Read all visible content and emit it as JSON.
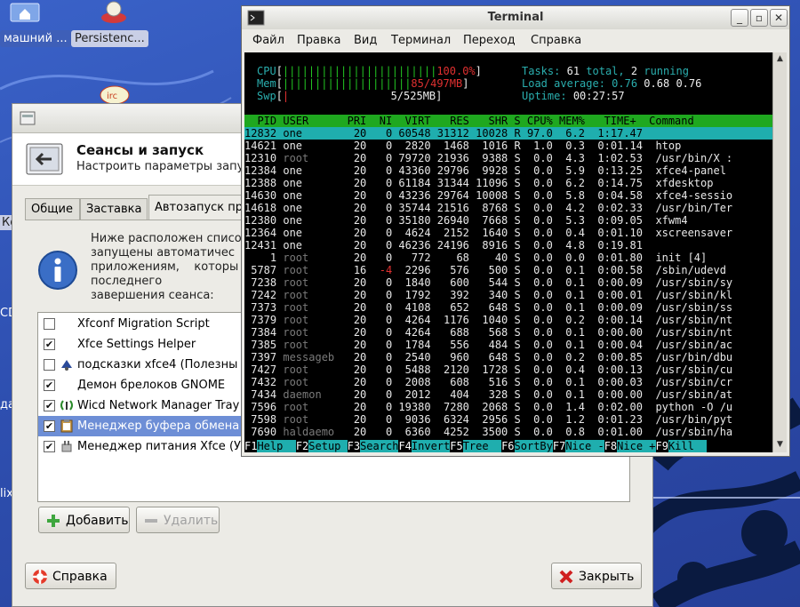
{
  "desktop": {
    "icons": [
      {
        "label": "машний ...",
        "icon": "home-icon"
      },
      {
        "label": "Persistenc...",
        "icon": "persistence-icon"
      }
    ],
    "side_labels": [
      "Ко",
      "CD",
      "да",
      "lix"
    ]
  },
  "settings_dialog": {
    "title": "Сеансы и запуск",
    "subtitle": "Настроить параметры запу",
    "tabs": [
      "Общие",
      "Заставка",
      "Автозапуск пр"
    ],
    "info_text": "Ниже расположен списо\nзапущены автоматичес\nприложениям,    которы\nпоследнего\nзавершения сеанса:",
    "autostart_items": [
      {
        "label": "Xfconf Migration Script",
        "checked": false,
        "icon": "none"
      },
      {
        "label": "Xfce Settings Helper",
        "checked": true,
        "icon": "none"
      },
      {
        "label": "подсказки xfce4 (Полезны",
        "checked": false,
        "icon": "tips-icon"
      },
      {
        "label": "Демон брелоков GNOME",
        "checked": true,
        "icon": "none"
      },
      {
        "label": "Wicd Network Manager Tray",
        "checked": true,
        "icon": "wicd-icon"
      },
      {
        "label": "Менеджер буфера обмена",
        "checked": true,
        "icon": "clipboard-icon"
      },
      {
        "label": "Менеджер питания Xfce (У",
        "checked": true,
        "icon": "power-icon"
      }
    ],
    "selected_index": 5,
    "add_button": "Добавить",
    "remove_button": "Удалить",
    "help_button": "Справка",
    "close_button": "Закрыть"
  },
  "terminal": {
    "title": "Terminal",
    "menu": [
      "Файл",
      "Правка",
      "Вид",
      "Терминал",
      "Переход",
      "Справка"
    ],
    "htop": {
      "cpu_label": "CPU",
      "cpu_bar": "||||||||||||||||||||||||",
      "cpu_value": "100.0%",
      "mem_label": "Mem",
      "mem_bar": "||||||||||||||||||||",
      "mem_value": "85/497MB",
      "swp_label": "Swp",
      "swp_bar": "|",
      "swp_value": "5/525MB",
      "tasks_label": "Tasks:",
      "tasks_total": "61",
      "tasks_total_label": "total,",
      "tasks_running": "2",
      "tasks_running_label": "running",
      "load_label": "Load average:",
      "load_1": "0.76",
      "load_5": "0.68",
      "load_15": "0.76",
      "uptime_label": "Uptime:",
      "uptime": "00:27:57",
      "header": "  PID USER      PRI  NI  VIRT   RES   SHR S CPU% MEM%   TIME+  Command",
      "processes": [
        {
          "pid": "12832",
          "user": "one",
          "pri": "20",
          "ni": "0",
          "virt": "60548",
          "res": "31312",
          "shr": "10028",
          "s": "R",
          "cpu": "97.0",
          "mem": "6.2",
          "time": "1:17.47",
          "cmd": ""
        },
        {
          "pid": "14621",
          "user": "one",
          "pri": "20",
          "ni": "0",
          "virt": "2820",
          "res": "1468",
          "shr": "1016",
          "s": "R",
          "cpu": "1.0",
          "mem": "0.3",
          "time": "0:01.14",
          "cmd": "htop"
        },
        {
          "pid": "12310",
          "user": "root",
          "pri": "20",
          "ni": "0",
          "virt": "79720",
          "res": "21936",
          "shr": "9388",
          "s": "S",
          "cpu": "0.0",
          "mem": "4.3",
          "time": "1:02.53",
          "cmd": "/usr/bin/X :"
        },
        {
          "pid": "12384",
          "user": "one",
          "pri": "20",
          "ni": "0",
          "virt": "43360",
          "res": "29796",
          "shr": "9928",
          "s": "S",
          "cpu": "0.0",
          "mem": "5.9",
          "time": "0:13.25",
          "cmd": "xfce4-panel"
        },
        {
          "pid": "12388",
          "user": "one",
          "pri": "20",
          "ni": "0",
          "virt": "61184",
          "res": "31344",
          "shr": "11096",
          "s": "S",
          "cpu": "0.0",
          "mem": "6.2",
          "time": "0:14.75",
          "cmd": "xfdesktop"
        },
        {
          "pid": "14630",
          "user": "one",
          "pri": "20",
          "ni": "0",
          "virt": "43236",
          "res": "29764",
          "shr": "10008",
          "s": "S",
          "cpu": "0.0",
          "mem": "5.8",
          "time": "0:04.58",
          "cmd": "xfce4-sessio"
        },
        {
          "pid": "14618",
          "user": "one",
          "pri": "20",
          "ni": "0",
          "virt": "35744",
          "res": "21516",
          "shr": "8768",
          "s": "S",
          "cpu": "0.0",
          "mem": "4.2",
          "time": "0:02.33",
          "cmd": "/usr/bin/Ter"
        },
        {
          "pid": "12380",
          "user": "one",
          "pri": "20",
          "ni": "0",
          "virt": "35180",
          "res": "26940",
          "shr": "7668",
          "s": "S",
          "cpu": "0.0",
          "mem": "5.3",
          "time": "0:09.05",
          "cmd": "xfwm4"
        },
        {
          "pid": "12364",
          "user": "one",
          "pri": "20",
          "ni": "0",
          "virt": "4624",
          "res": "2152",
          "shr": "1640",
          "s": "S",
          "cpu": "0.0",
          "mem": "0.4",
          "time": "0:01.10",
          "cmd": "xscreensaver"
        },
        {
          "pid": "12431",
          "user": "one",
          "pri": "20",
          "ni": "0",
          "virt": "46236",
          "res": "24196",
          "shr": "8916",
          "s": "S",
          "cpu": "0.0",
          "mem": "4.8",
          "time": "0:19.81",
          "cmd": ""
        },
        {
          "pid": "1",
          "user": "root",
          "pri": "20",
          "ni": "0",
          "virt": "772",
          "res": "68",
          "shr": "40",
          "s": "S",
          "cpu": "0.0",
          "mem": "0.0",
          "time": "0:01.80",
          "cmd": "init [4]"
        },
        {
          "pid": "5787",
          "user": "root",
          "pri": "16",
          "ni": "-4",
          "virt": "2296",
          "res": "576",
          "shr": "500",
          "s": "S",
          "cpu": "0.0",
          "mem": "0.1",
          "time": "0:00.58",
          "cmd": "/sbin/udevd"
        },
        {
          "pid": "7238",
          "user": "root",
          "pri": "20",
          "ni": "0",
          "virt": "1840",
          "res": "600",
          "shr": "544",
          "s": "S",
          "cpu": "0.0",
          "mem": "0.1",
          "time": "0:00.09",
          "cmd": "/usr/sbin/sy"
        },
        {
          "pid": "7242",
          "user": "root",
          "pri": "20",
          "ni": "0",
          "virt": "1792",
          "res": "392",
          "shr": "340",
          "s": "S",
          "cpu": "0.0",
          "mem": "0.1",
          "time": "0:00.01",
          "cmd": "/usr/sbin/kl"
        },
        {
          "pid": "7373",
          "user": "root",
          "pri": "20",
          "ni": "0",
          "virt": "4108",
          "res": "652",
          "shr": "648",
          "s": "S",
          "cpu": "0.0",
          "mem": "0.1",
          "time": "0:00.09",
          "cmd": "/usr/sbin/ss"
        },
        {
          "pid": "7379",
          "user": "root",
          "pri": "20",
          "ni": "0",
          "virt": "4264",
          "res": "1176",
          "shr": "1040",
          "s": "S",
          "cpu": "0.0",
          "mem": "0.2",
          "time": "0:00.14",
          "cmd": "/usr/sbin/nt"
        },
        {
          "pid": "7384",
          "user": "root",
          "pri": "20",
          "ni": "0",
          "virt": "4264",
          "res": "688",
          "shr": "568",
          "s": "S",
          "cpu": "0.0",
          "mem": "0.1",
          "time": "0:00.00",
          "cmd": "/usr/sbin/nt"
        },
        {
          "pid": "7385",
          "user": "root",
          "pri": "20",
          "ni": "0",
          "virt": "1784",
          "res": "556",
          "shr": "484",
          "s": "S",
          "cpu": "0.0",
          "mem": "0.1",
          "time": "0:00.04",
          "cmd": "/usr/sbin/ac"
        },
        {
          "pid": "7397",
          "user": "messageb",
          "pri": "20",
          "ni": "0",
          "virt": "2540",
          "res": "960",
          "shr": "648",
          "s": "S",
          "cpu": "0.0",
          "mem": "0.2",
          "time": "0:00.85",
          "cmd": "/usr/bin/dbu"
        },
        {
          "pid": "7427",
          "user": "root",
          "pri": "20",
          "ni": "0",
          "virt": "5488",
          "res": "2120",
          "shr": "1728",
          "s": "S",
          "cpu": "0.0",
          "mem": "0.4",
          "time": "0:00.13",
          "cmd": "/usr/sbin/cu"
        },
        {
          "pid": "7432",
          "user": "root",
          "pri": "20",
          "ni": "0",
          "virt": "2008",
          "res": "608",
          "shr": "516",
          "s": "S",
          "cpu": "0.0",
          "mem": "0.1",
          "time": "0:00.03",
          "cmd": "/usr/sbin/cr"
        },
        {
          "pid": "7434",
          "user": "daemon",
          "pri": "20",
          "ni": "0",
          "virt": "2012",
          "res": "404",
          "shr": "328",
          "s": "S",
          "cpu": "0.0",
          "mem": "0.1",
          "time": "0:00.00",
          "cmd": "/usr/sbin/at"
        },
        {
          "pid": "7596",
          "user": "root",
          "pri": "20",
          "ni": "0",
          "virt": "19380",
          "res": "7280",
          "shr": "2068",
          "s": "S",
          "cpu": "0.0",
          "mem": "1.4",
          "time": "0:02.00",
          "cmd": "python -O /u"
        },
        {
          "pid": "7598",
          "user": "root",
          "pri": "20",
          "ni": "0",
          "virt": "9036",
          "res": "6324",
          "shr": "2956",
          "s": "S",
          "cpu": "0.0",
          "mem": "1.2",
          "time": "0:01.23",
          "cmd": "/usr/bin/pyt"
        },
        {
          "pid": "7690",
          "user": "haldaemo",
          "pri": "20",
          "ni": "0",
          "virt": "6360",
          "res": "4252",
          "shr": "3500",
          "s": "S",
          "cpu": "0.0",
          "mem": "0.8",
          "time": "0:01.00",
          "cmd": "/usr/sbin/ha"
        }
      ],
      "fkeys": [
        {
          "key": "F1",
          "label": "Help  "
        },
        {
          "key": "F2",
          "label": "Setup "
        },
        {
          "key": "F3",
          "label": "Search"
        },
        {
          "key": "F4",
          "label": "Invert"
        },
        {
          "key": "F5",
          "label": "Tree  "
        },
        {
          "key": "F6",
          "label": "SortBy"
        },
        {
          "key": "F7",
          "label": "Nice -"
        },
        {
          "key": "F8",
          "label": "Nice +"
        },
        {
          "key": "F9",
          "label": "Kill  "
        }
      ]
    }
  },
  "colors": {
    "htop_green": "#22c422",
    "htop_cyan": "#1faeae",
    "selection_blue": "#6d8ed6"
  }
}
